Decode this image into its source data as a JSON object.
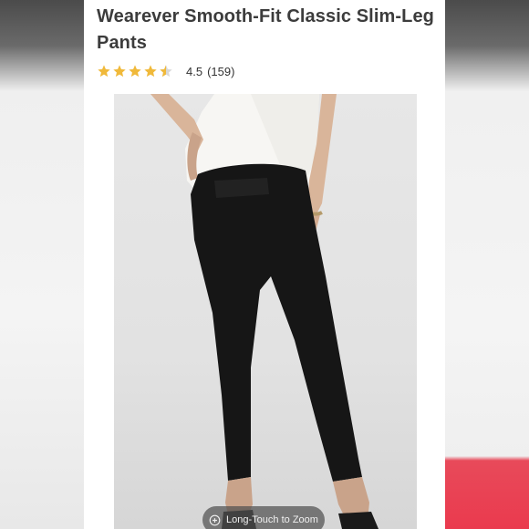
{
  "product": {
    "title": "Wearever Smooth-Fit Classic Slim-Leg Pants",
    "rating_value": "4.5",
    "review_count": "(159)",
    "rating_fraction": 0.9
  },
  "image": {
    "description_label": "product-photo",
    "zoom_hint": "Long-Touch to Zoom"
  },
  "colors": {
    "star": "#f0b93a",
    "star_empty": "#d8d8d8",
    "title": "#3c3c3c"
  }
}
